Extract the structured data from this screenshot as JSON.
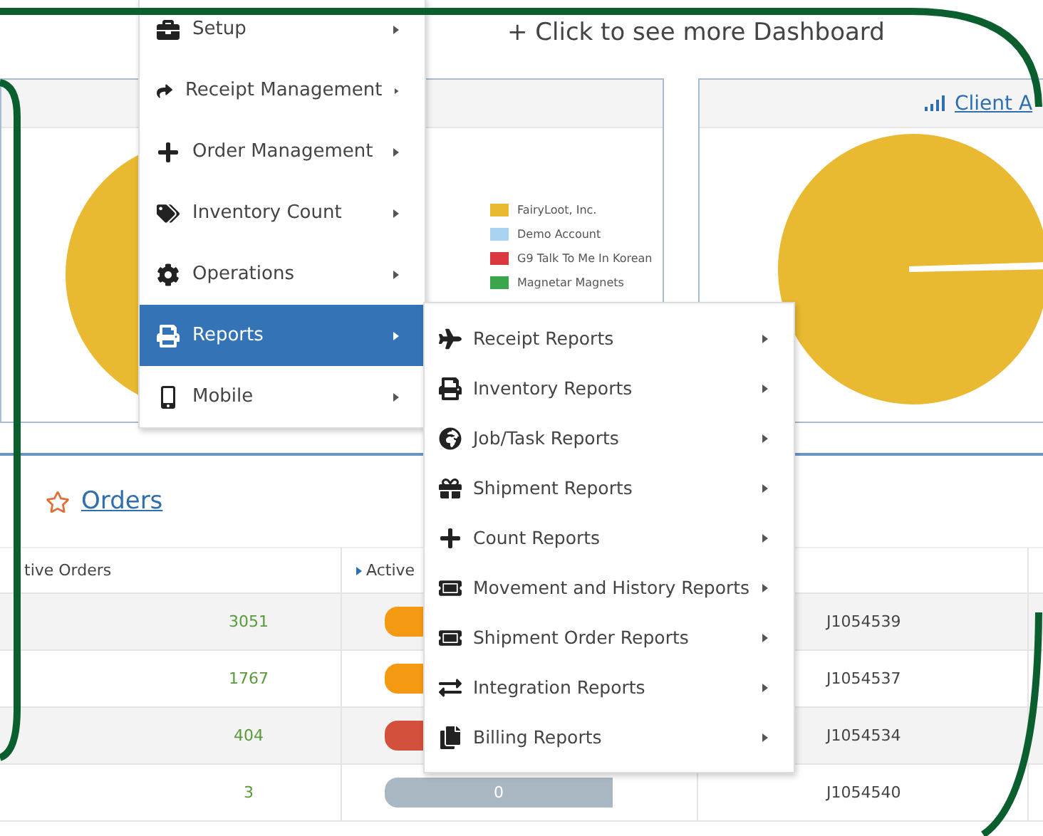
{
  "header": {
    "link": "+ Click to see more Dashboard"
  },
  "left_panel": {
    "legend": [
      {
        "label": "FairyLoot, Inc.",
        "color": "#e8b931"
      },
      {
        "label": "Demo Account",
        "color": "#a9d3f0"
      },
      {
        "label": "G9 Talk To Me In Korean",
        "color": "#d9393e"
      },
      {
        "label": "Magnetar Magnets",
        "color": "#3aa54a"
      }
    ]
  },
  "right_panel": {
    "title": "Client A"
  },
  "orders": {
    "title": "Orders",
    "columns": [
      "tive Orders",
      "Active"
    ],
    "rows": [
      {
        "count": "3051",
        "color": "#f39a12",
        "job": "J1054539"
      },
      {
        "count": "1767",
        "color": "#f39a12",
        "job": "J1054537"
      },
      {
        "count": "404",
        "color": "#d2503c",
        "job": "J1054534"
      },
      {
        "count": "3",
        "color": "#a9b7c2",
        "bar_label": "0",
        "job": "J1054540"
      }
    ]
  },
  "menu": {
    "items": [
      {
        "label": "Setup",
        "selected": false
      },
      {
        "label": "Receipt Management",
        "selected": false
      },
      {
        "label": "Order Management",
        "selected": false
      },
      {
        "label": "Inventory Count",
        "selected": false
      },
      {
        "label": "Operations",
        "selected": false
      },
      {
        "label": "Reports",
        "selected": true
      },
      {
        "label": "Mobile",
        "selected": false
      }
    ]
  },
  "submenu": {
    "items": [
      {
        "label": "Receipt Reports"
      },
      {
        "label": "Inventory Reports"
      },
      {
        "label": "Job/Task Reports"
      },
      {
        "label": "Shipment Reports"
      },
      {
        "label": "Count Reports"
      },
      {
        "label": "Movement and History Reports"
      },
      {
        "label": "Shipment Order Reports"
      },
      {
        "label": "Integration Reports"
      },
      {
        "label": "Billing Reports"
      }
    ]
  }
}
